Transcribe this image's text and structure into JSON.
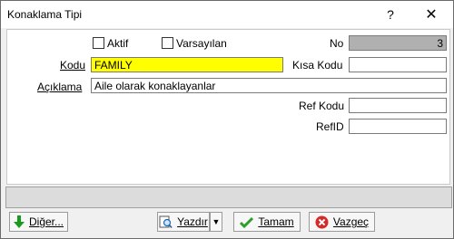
{
  "window": {
    "title": "Konaklama Tipi",
    "help_glyph": "?",
    "close_glyph": "✕"
  },
  "form": {
    "aktif_label": "Aktif",
    "varsayilan_label": "Varsayılan",
    "no_label": "No",
    "no_value": "3",
    "kodu_label": "Kodu",
    "kodu_value": "FAMILY",
    "kisa_kodu_label": "Kısa Kodu",
    "kisa_kodu_value": "",
    "aciklama_label": "Açıklama",
    "aciklama_value": "Aile olarak konaklayanlar",
    "ref_kodu_label": "Ref Kodu",
    "ref_kodu_value": "",
    "refid_label": "RefID",
    "refid_value": ""
  },
  "buttons": {
    "diger": "Diğer...",
    "yazdir": "Yazdır",
    "tamam": "Tamam",
    "vazgec": "Vazgeç"
  },
  "icons": {
    "diger": "green-down-arrow-icon",
    "yazdir": "print-preview-icon",
    "tamam": "green-check-icon",
    "vazgec": "red-x-icon"
  },
  "colors": {
    "kodu_field_bg": "#ffff00",
    "no_field_bg": "#b0b0b0"
  }
}
